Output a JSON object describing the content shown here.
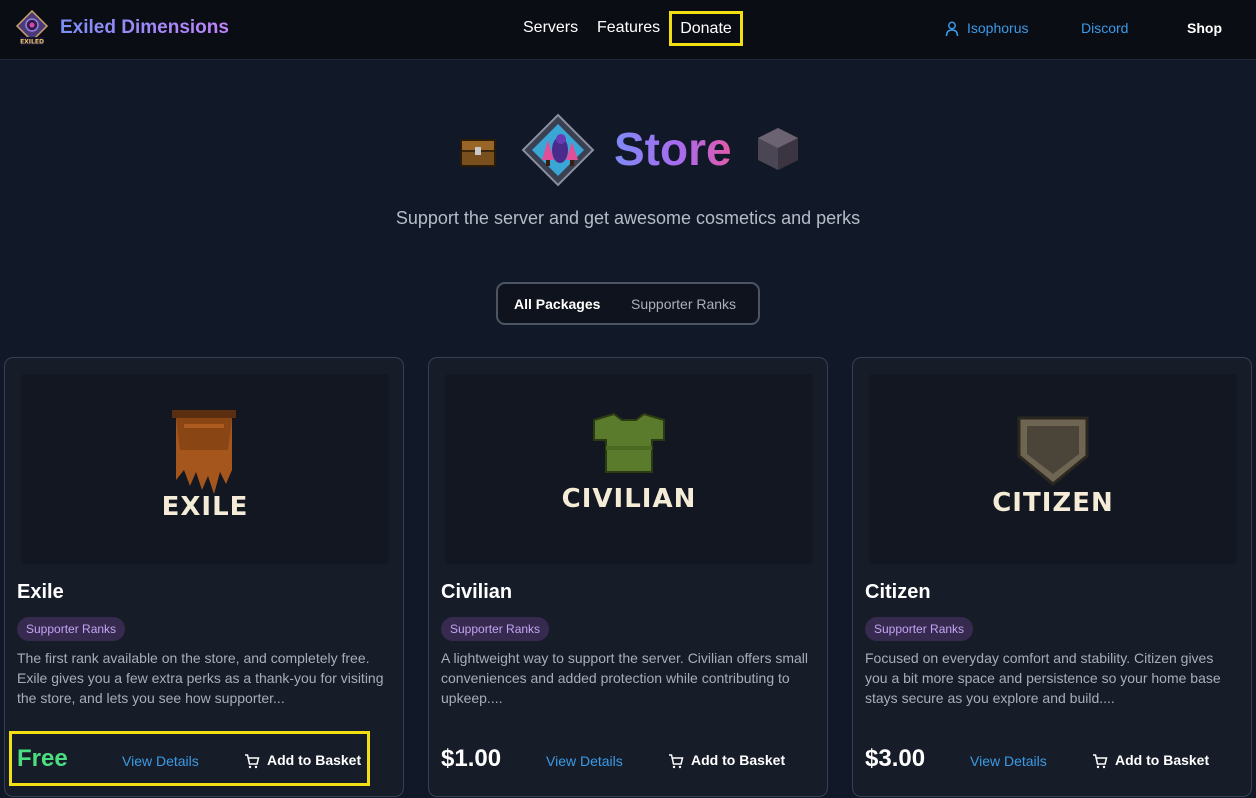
{
  "nav": {
    "brand": "Exiled Dimensions",
    "logo_text": "EXILED",
    "links": [
      "Servers",
      "Features",
      "Donate"
    ],
    "user": "Isophorus",
    "discord": "Discord",
    "shop": "Shop",
    "user_icon": "user-icon"
  },
  "hero": {
    "title": "Store",
    "subtitle": "Support the server and get awesome cosmetics and perks"
  },
  "tabs": [
    "All Packages",
    "Supporter Ranks"
  ],
  "cards": [
    {
      "rank_art_text": "EXILE",
      "title": "Exile",
      "badge": "Supporter Ranks",
      "description": "The first rank available on the store, and completely free. Exile gives you a few extra perks as a thank-you for visiting the store, and lets you see how supporter...",
      "price": "Free",
      "view": "View Details",
      "add": "Add to Basket"
    },
    {
      "rank_art_text": "CIVILIAN",
      "title": "Civilian",
      "badge": "Supporter Ranks",
      "description": "A lightweight way to support the server. Civilian offers small conveniences and added protection while contributing to upkeep....",
      "price": "$1.00",
      "view": "View Details",
      "add": "Add to Basket"
    },
    {
      "rank_art_text": "CITIZEN",
      "title": "Citizen",
      "badge": "Supporter Ranks",
      "description": "Focused on everyday comfort and stability. Citizen gives you a bit more space and persistence so your home base stays secure as you explore and build....",
      "price": "$3.00",
      "view": "View Details",
      "add": "Add to Basket"
    }
  ],
  "colors": {
    "accent_link": "#3b9ae6",
    "free_price": "#4ade80",
    "highlight": "#f3e012",
    "badge_bg": "#362a4f"
  }
}
